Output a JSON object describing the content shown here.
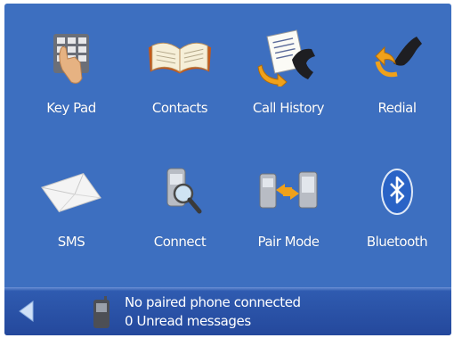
{
  "menu": {
    "items": [
      {
        "label": "Key Pad",
        "icon": "keypad-icon"
      },
      {
        "label": "Contacts",
        "icon": "contacts-book-icon"
      },
      {
        "label": "Call History",
        "icon": "call-history-icon"
      },
      {
        "label": "Redial",
        "icon": "redial-icon"
      },
      {
        "label": "SMS",
        "icon": "sms-envelope-icon"
      },
      {
        "label": "Connect",
        "icon": "connect-phone-search-icon"
      },
      {
        "label": "Pair Mode",
        "icon": "pair-mode-icon"
      },
      {
        "label": "Bluetooth",
        "icon": "bluetooth-icon"
      }
    ]
  },
  "status": {
    "line1": "No paired phone connected",
    "line2": "0 Unread messages",
    "back_icon": "back-arrow-icon",
    "phone_icon": "phone-icon"
  },
  "colors": {
    "background": "#3d6fc0",
    "statusbar": "#24489c",
    "text": "#ffffff"
  }
}
